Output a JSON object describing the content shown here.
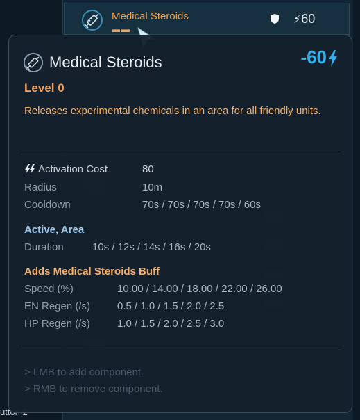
{
  "background": {
    "item_name": "Medical Steroids",
    "item_dashes": "▬▬",
    "item_cost": "60",
    "bottom_label": "utton 2"
  },
  "tooltip": {
    "title": "Medical Steroids",
    "energy": "-60",
    "level": "Level 0",
    "description": "Releases experimental chemicals in an area for all friendly units.",
    "stats": [
      {
        "label": "Activation Cost",
        "value": "80"
      },
      {
        "label": "Radius",
        "value": "10m"
      },
      {
        "label": "Cooldown",
        "value": "70s / 70s / 70s / 70s / 60s"
      }
    ],
    "section1": {
      "title": "Active, Area",
      "rows": [
        {
          "label": "Duration",
          "value": "10s / 12s / 14s / 16s / 20s"
        }
      ]
    },
    "section2": {
      "title": "Adds Medical Steroids Buff",
      "rows": [
        {
          "label": "Speed (%)",
          "value": "10.00 / 14.00 / 18.00 / 22.00 / 26.00"
        },
        {
          "label": "EN Regen (/s)",
          "value": "0.5 / 1.0 / 1.5 / 2.0 / 2.5"
        },
        {
          "label": "HP Regen (/s)",
          "value": "1.0 / 1.5 / 2.0 / 2.5 / 3.0"
        }
      ]
    },
    "hints": [
      "> LMB to add component.",
      "> RMB to remove component."
    ]
  },
  "colors": {
    "accent_orange": "#f6a055",
    "energy_blue": "#2fb0f0",
    "panel_bg": "#15212d"
  }
}
